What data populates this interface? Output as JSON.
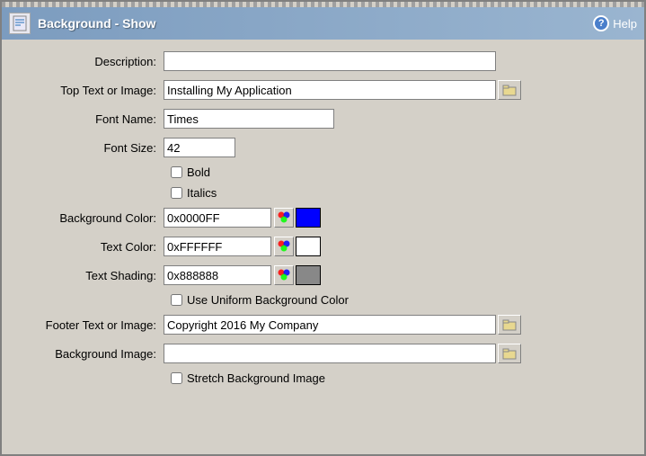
{
  "window": {
    "title": "Background - Show",
    "help_label": "Help"
  },
  "form": {
    "description_label": "Description:",
    "description_value": "",
    "top_text_label": "Top Text or Image:",
    "top_text_value": "Installing My Application",
    "font_name_label": "Font Name:",
    "font_name_value": "Times",
    "font_size_label": "Font Size:",
    "font_size_value": "42",
    "bold_label": "Bold",
    "italics_label": "Italics",
    "bg_color_label": "Background Color:",
    "bg_color_value": "0x0000FF",
    "bg_color_hex": "#0000FF",
    "text_color_label": "Text Color:",
    "text_color_value": "0xFFFFFF",
    "text_color_hex": "#FFFFFF",
    "text_shading_label": "Text Shading:",
    "text_shading_value": "0x888888",
    "text_shading_hex": "#888888",
    "use_uniform_label": "Use Uniform Background Color",
    "footer_text_label": "Footer Text or Image:",
    "footer_text_value": "Copyright 2016 My Company",
    "bg_image_label": "Background Image:",
    "bg_image_value": "",
    "stretch_label": "Stretch Background Image"
  }
}
